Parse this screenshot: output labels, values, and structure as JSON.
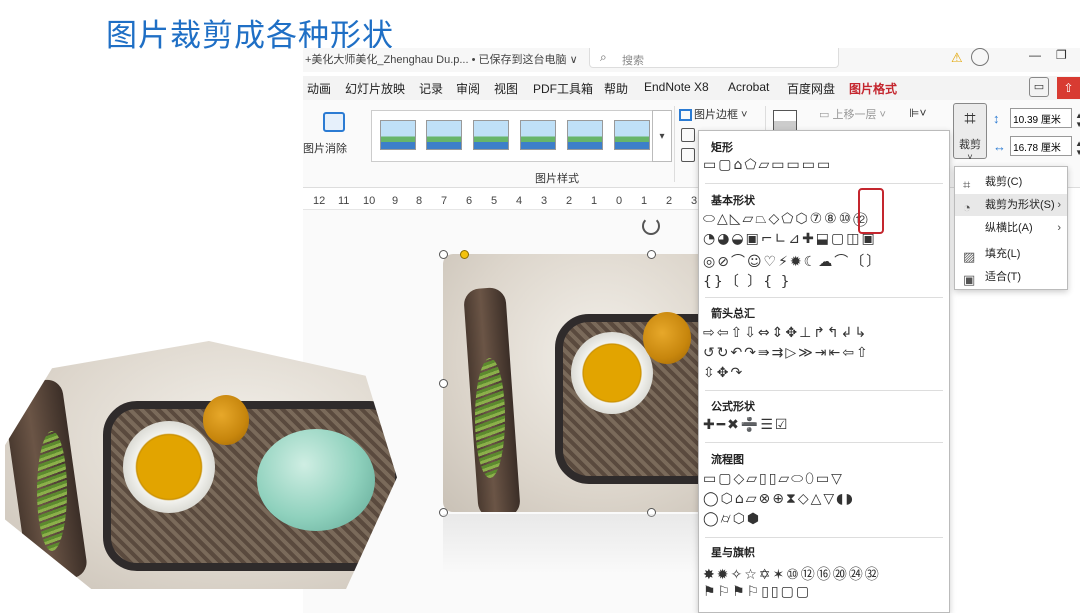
{
  "slide": {
    "title": "图片裁剪成各种形状"
  },
  "titlebar": {
    "doc_name": "+美化大师美化_Zhenghau Du.p... • 已保存到这台电脑 ∨",
    "search_placeholder": "搜索"
  },
  "ribbon_tabs": [
    "动画",
    "幻灯片放映",
    "记录",
    "审阅",
    "视图",
    "PDF工具箱",
    "帮助",
    "EndNote X8",
    "Acrobat",
    "百度网盘",
    "图片格式"
  ],
  "ribbon": {
    "remove_bg": "图片消除",
    "styles_group": "图片样式",
    "border": "图片边框",
    "bring_forward": "上移一层",
    "crop": "裁剪",
    "height": "10.39 厘米",
    "width": "16.78 厘米"
  },
  "ruler": [
    "12",
    "11",
    "10",
    "9",
    "8",
    "7",
    "6",
    "5",
    "4",
    "3",
    "2",
    "1",
    "0",
    "1",
    "2",
    "3"
  ],
  "shape_panel": {
    "categories": [
      "矩形",
      "基本形状",
      "箭头总汇",
      "公式形状",
      "流程图",
      "星与旗帜"
    ],
    "rect_row": "▭▢⌂⬠▱▭▭▭▭",
    "basic_rows": [
      "⬭△◺▱⏢◇⬠⬡⑦⑧⑩⑫",
      "◔◕◒▣⌐∟⊿✚⬓▢◫▣",
      "◎⊘⌒☺♡⚡✹☾☁⌒〔〕",
      "{}〔 〕{ }"
    ],
    "arrow_rows": [
      "⇨⇦⇧⇩⇔⇕✥⊥↱↰↲↳",
      "↺↻↶↷⇛⇉▷≫⇥⇤⇦⇧",
      "⇳✥↷"
    ],
    "formula_row": "✚━✖➗☰☑",
    "flow_rows": [
      "▭▢◇▱▯▯▱⬭⬯▭▽",
      "◯⬡⌂▱⊗⊕⧗◇△▽◖◗",
      "◯⌭⬡⬢"
    ],
    "star_rows": [
      "✸✹✧☆✡✶⑩⑫⑯⑳㉔㉜",
      "⚑⚐⚑⚐▯▯▢▢"
    ]
  },
  "crop_menu": {
    "items": [
      "裁剪(C)",
      "裁剪为形状(S)",
      "纵横比(A)",
      "填充(L)",
      "适合(T)"
    ]
  },
  "colors": {
    "title": "#1f6fc5",
    "active_tab": "#c4262e",
    "highlight": "#c4262e"
  }
}
